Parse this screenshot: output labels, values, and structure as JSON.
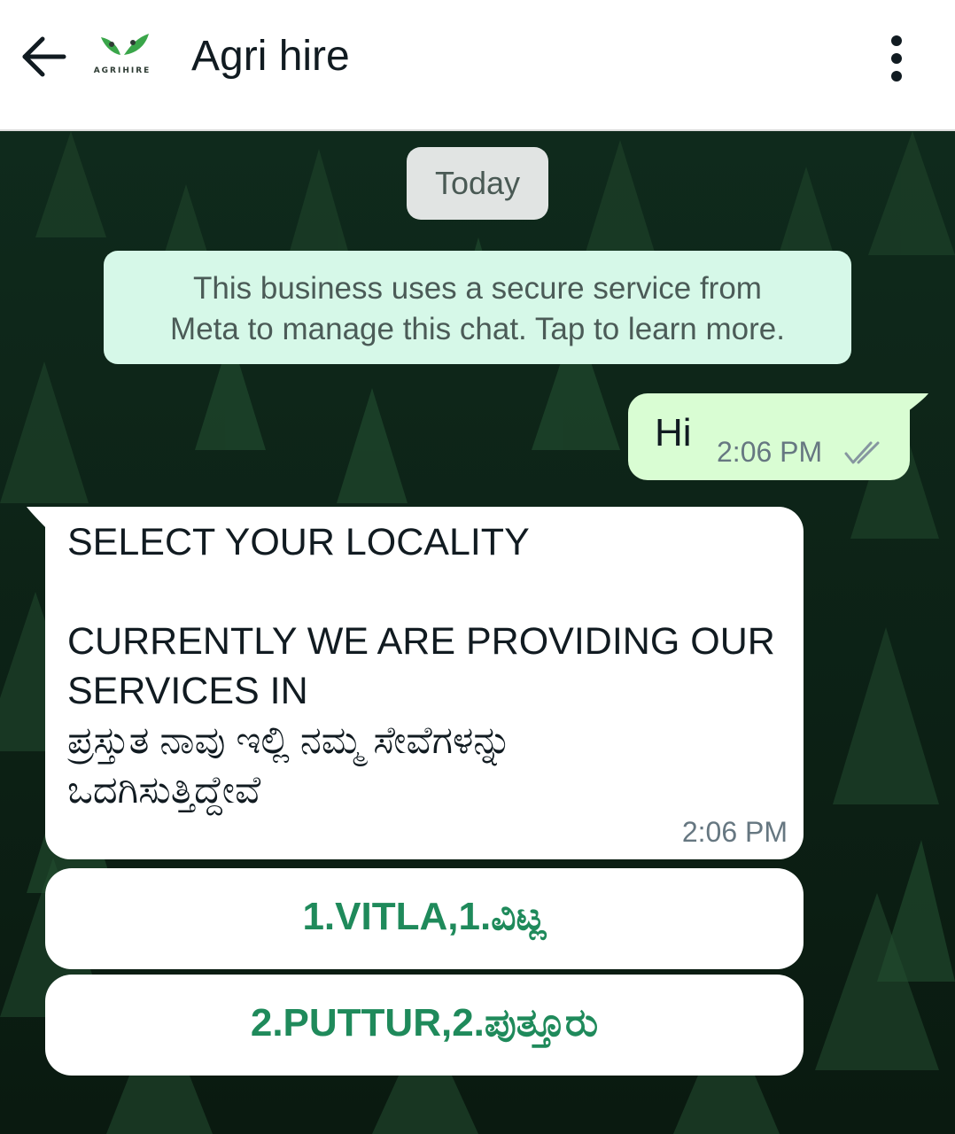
{
  "header": {
    "logo_text": "AGRIHIRE",
    "title": "Agri hire",
    "back_icon": "arrow-left-icon",
    "menu_icon": "more-vertical-icon"
  },
  "chat": {
    "date_chip": "Today",
    "system_notice": "This business uses a secure service from\nMeta to manage this chat. Tap to learn more.",
    "outgoing": {
      "text": "Hi",
      "time": "2:06 PM",
      "status_icon": "double-check-icon"
    },
    "incoming": {
      "text": "SELECT YOUR LOCALITY\n\nCURRENTLY WE ARE PROVIDING OUR\nSERVICES IN\nಪ್ರಸ್ತುತ ನಾವು ಇಲ್ಲಿ ನಮ್ಮ ಸೇವೆಗಳನ್ನು\nಒದಗಿಸುತ್ತಿದ್ದೇವೆ",
      "time": "2:06 PM"
    },
    "quick_replies": [
      {
        "label": "1.VITLA,1.ವಿಟ್ಲ"
      },
      {
        "label": "2.PUTTUR,2.ಪುತ್ತೂರು"
      }
    ]
  },
  "colors": {
    "header_bg": "#ffffff",
    "chat_bg": "#0d1f14",
    "outgoing_bubble": "#d9fdd3",
    "notice_bg": "#d6f8e8",
    "reply_text": "#1f8a5b",
    "logo_green": "#3aa64a"
  }
}
